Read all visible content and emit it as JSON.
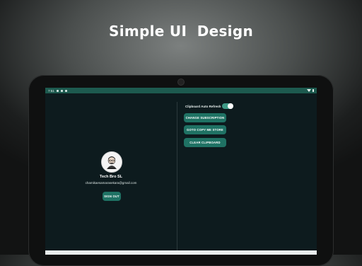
{
  "headline": "Simple UI  Design",
  "status_bar": {
    "time": "7:51",
    "icons": [
      "notification-icon",
      "app-icon",
      "message-icon",
      "wifi-icon",
      "battery-icon"
    ]
  },
  "profile": {
    "name": "Tech Bro SL",
    "email": "chamikaesamarasekara@gmail.com",
    "sign_out_label": "SIGN OUT"
  },
  "settings": {
    "clipboard_auto_refresh_label": "Clipboard Auto Refresh",
    "clipboard_auto_refresh_on": true,
    "buttons": [
      "CHANGE SUBSCRIPTION",
      "GOTO COPY ME STORE",
      "CLEAR CLIPBOARD"
    ]
  },
  "colors": {
    "accent": "#1f7264",
    "screen_bg": "#0d1b1e",
    "status_bar": "#1d5a4f"
  }
}
